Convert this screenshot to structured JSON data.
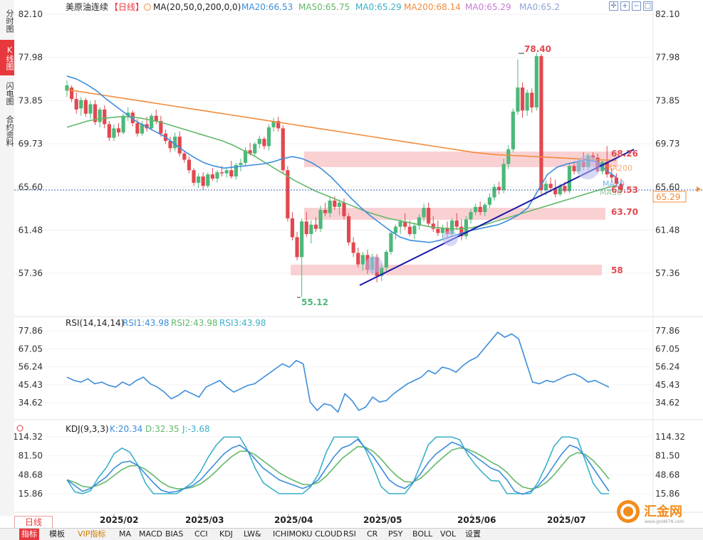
{
  "sidebar": {
    "tabs": [
      {
        "label": "分时图",
        "active": false
      },
      {
        "label": "K线图",
        "active": true
      },
      {
        "label": "闪电图",
        "active": false
      },
      {
        "label": "合约资料",
        "active": false
      }
    ]
  },
  "header": {
    "symbol": "美原油连续",
    "period_tag": "【日线】",
    "ma_params": "MA(20,50,0,200,0,0)",
    "ma_values": [
      {
        "label": "MA20:66.53",
        "color": "#3c8ddb"
      },
      {
        "label": "MA50:65.75",
        "color": "#63b86a"
      },
      {
        "label": "MA0:65.29",
        "color": "#3ab0c8"
      },
      {
        "label": "MA200:68.14",
        "color": "#f28c3c"
      },
      {
        "label": "MA0:65.29",
        "color": "#c97ad6"
      },
      {
        "label": "MA0:65.2",
        "color": "#8ea3d8"
      }
    ]
  },
  "price_axis": {
    "ticks": [
      "82.10",
      "77.98",
      "73.85",
      "69.73",
      "65.60",
      "61.48",
      "57.36"
    ],
    "current_price": "65.29"
  },
  "annotations": {
    "high": "78.40",
    "low": "55.12",
    "zone_labels": [
      "68.26",
      "63.70",
      "58",
      "65.53"
    ],
    "ma_tags": [
      "MA20",
      "MA200",
      "MA50"
    ]
  },
  "rsi": {
    "title": "RSI(14,14,14)",
    "values": [
      {
        "label": "RSI1:43.98",
        "color": "#3c8ddb"
      },
      {
        "label": "RSI2:43.98",
        "color": "#63b86a"
      },
      {
        "label": "RSI3:43.98",
        "color": "#3ab0c8"
      }
    ],
    "ticks": [
      "77.86",
      "67.05",
      "56.24",
      "45.43",
      "34.62"
    ]
  },
  "kdj": {
    "title": "KDJ(9,3,3)",
    "values": [
      {
        "label": "K:20.34",
        "color": "#3c8ddb"
      },
      {
        "label": "D:32.35",
        "color": "#63b86a"
      },
      {
        "label": "J:-3.68",
        "color": "#3ab0c8"
      }
    ],
    "ticks": [
      "114.32",
      "81.50",
      "48.68",
      "15.86"
    ]
  },
  "time_axis": {
    "labels": [
      "2025/02",
      "2025/03",
      "2025/04",
      "2025/05",
      "2025/06",
      "2025/07"
    ]
  },
  "period_button": "日线",
  "toolbar": [
    {
      "label": "指标",
      "active": true
    },
    {
      "label": "模板"
    },
    {
      "label": "VIP指标",
      "vip": true
    },
    {
      "label": "MA"
    },
    {
      "label": "MACD"
    },
    {
      "label": "BIAS"
    },
    {
      "label": "CCI"
    },
    {
      "label": "KDJ"
    },
    {
      "label": "LW&"
    },
    {
      "label": "ICHIMOKU CLOUD"
    },
    {
      "label": "RSI"
    },
    {
      "label": "CR"
    },
    {
      "label": "PSY"
    },
    {
      "label": "BOLL"
    },
    {
      "label": "VOL"
    },
    {
      "label": "设置"
    }
  ],
  "logo": {
    "text": "汇金网",
    "url_text": "www.gold678.com"
  },
  "chart_data": {
    "type": "candlestick",
    "title": "美原油连续【日线】",
    "y_range": [
      53.5,
      83.2
    ],
    "y_ticks": [
      82.1,
      77.98,
      73.85,
      69.73,
      65.6,
      61.48,
      57.36
    ],
    "x_labels": [
      "2025/02",
      "2025/03",
      "2025/04",
      "2025/05",
      "2025/06",
      "2025/07"
    ],
    "candles_ohlc": [
      [
        74.8,
        75.8,
        74.2,
        75.3
      ],
      [
        75.1,
        75.3,
        73.7,
        74.0
      ],
      [
        74.0,
        74.6,
        72.6,
        73.0
      ],
      [
        73.1,
        74.2,
        72.4,
        73.9
      ],
      [
        73.9,
        74.1,
        72.3,
        72.6
      ],
      [
        72.6,
        73.8,
        72.1,
        73.5
      ],
      [
        73.5,
        73.9,
        71.5,
        71.8
      ],
      [
        71.8,
        73.2,
        71.3,
        73.0
      ],
      [
        73.0,
        73.4,
        71.2,
        71.6
      ],
      [
        71.6,
        71.9,
        70.0,
        70.3
      ],
      [
        70.3,
        71.6,
        70.0,
        71.2
      ],
      [
        71.2,
        71.7,
        70.4,
        70.8
      ],
      [
        70.8,
        72.6,
        70.6,
        72.4
      ],
      [
        72.4,
        73.2,
        71.9,
        72.7
      ],
      [
        72.7,
        72.9,
        71.4,
        71.7
      ],
      [
        71.7,
        72.1,
        70.4,
        70.7
      ],
      [
        70.7,
        71.9,
        70.5,
        71.6
      ],
      [
        71.6,
        72.3,
        70.9,
        71.2
      ],
      [
        71.2,
        72.6,
        71.0,
        72.4
      ],
      [
        72.4,
        73.0,
        71.6,
        71.9
      ],
      [
        71.9,
        72.4,
        70.4,
        70.7
      ],
      [
        70.7,
        71.1,
        69.7,
        70.0
      ],
      [
        70.0,
        70.4,
        68.9,
        69.3
      ],
      [
        69.3,
        70.8,
        69.0,
        70.4
      ],
      [
        70.4,
        70.9,
        68.5,
        68.8
      ],
      [
        68.8,
        69.1,
        67.9,
        68.2
      ],
      [
        68.2,
        68.5,
        66.9,
        67.2
      ],
      [
        67.2,
        67.4,
        65.7,
        66.0
      ],
      [
        66.0,
        66.9,
        65.5,
        66.6
      ],
      [
        66.6,
        67.0,
        65.3,
        65.7
      ],
      [
        65.7,
        67.0,
        65.5,
        66.8
      ],
      [
        66.8,
        67.4,
        66.2,
        66.4
      ],
      [
        66.4,
        67.2,
        66.0,
        67.0
      ],
      [
        67.0,
        67.6,
        66.6,
        66.9
      ],
      [
        66.9,
        67.4,
        66.5,
        67.2
      ],
      [
        67.2,
        68.1,
        66.4,
        66.6
      ],
      [
        66.6,
        67.9,
        66.3,
        67.7
      ],
      [
        67.7,
        68.3,
        67.1,
        67.9
      ],
      [
        67.9,
        69.4,
        67.6,
        69.1
      ],
      [
        69.1,
        69.8,
        68.6,
        68.8
      ],
      [
        68.8,
        69.9,
        68.5,
        69.7
      ],
      [
        69.7,
        70.5,
        69.3,
        70.2
      ],
      [
        70.2,
        70.4,
        69.2,
        69.5
      ],
      [
        69.5,
        71.6,
        69.1,
        71.3
      ],
      [
        71.3,
        72.2,
        70.9,
        71.9
      ],
      [
        71.9,
        72.3,
        70.9,
        71.2
      ],
      [
        71.2,
        71.5,
        66.9,
        67.2
      ],
      [
        67.2,
        67.6,
        62.3,
        62.6
      ],
      [
        62.6,
        63.2,
        60.5,
        60.8
      ],
      [
        60.8,
        61.3,
        58.6,
        58.9
      ],
      [
        58.9,
        62.6,
        55.1,
        62.3
      ],
      [
        62.3,
        63.2,
        60.8,
        61.1
      ],
      [
        61.1,
        62.4,
        60.2,
        62.0
      ],
      [
        62.0,
        62.7,
        61.3,
        61.6
      ],
      [
        61.6,
        63.8,
        61.3,
        63.4
      ],
      [
        63.4,
        64.1,
        62.8,
        63.1
      ],
      [
        63.1,
        64.6,
        62.7,
        64.3
      ],
      [
        64.3,
        64.7,
        63.4,
        63.7
      ],
      [
        63.7,
        64.4,
        62.9,
        64.1
      ],
      [
        64.1,
        64.5,
        62.5,
        62.8
      ],
      [
        62.8,
        63.1,
        60.0,
        60.3
      ],
      [
        60.3,
        60.8,
        58.9,
        59.3
      ],
      [
        59.3,
        59.8,
        57.9,
        58.2
      ],
      [
        58.2,
        59.4,
        57.6,
        59.1
      ],
      [
        59.1,
        59.6,
        57.3,
        57.7
      ],
      [
        57.7,
        59.2,
        57.3,
        58.9
      ],
      [
        58.9,
        59.2,
        56.5,
        57.1
      ],
      [
        57.1,
        58.3,
        56.6,
        57.9
      ],
      [
        57.9,
        59.6,
        57.6,
        59.4
      ],
      [
        59.4,
        61.4,
        59.1,
        61.2
      ],
      [
        61.2,
        62.0,
        60.6,
        61.8
      ],
      [
        61.8,
        62.5,
        61.1,
        62.3
      ],
      [
        62.3,
        63.1,
        61.5,
        61.8
      ],
      [
        61.8,
        62.4,
        60.9,
        61.1
      ],
      [
        61.1,
        62.2,
        60.6,
        61.9
      ],
      [
        61.9,
        63.0,
        61.5,
        62.7
      ],
      [
        62.7,
        64.0,
        62.3,
        63.6
      ],
      [
        63.6,
        64.1,
        61.8,
        62.1
      ],
      [
        62.1,
        62.8,
        61.3,
        61.6
      ],
      [
        61.6,
        62.4,
        60.9,
        61.2
      ],
      [
        61.2,
        62.0,
        60.6,
        61.7
      ],
      [
        61.7,
        62.3,
        60.8,
        61.1
      ],
      [
        61.1,
        62.6,
        60.9,
        62.4
      ],
      [
        62.4,
        63.1,
        61.5,
        61.8
      ],
      [
        61.8,
        62.5,
        60.5,
        60.9
      ],
      [
        60.9,
        62.8,
        60.6,
        62.5
      ],
      [
        62.5,
        63.5,
        62.1,
        63.2
      ],
      [
        63.2,
        64.0,
        62.9,
        63.7
      ],
      [
        63.7,
        64.2,
        62.9,
        63.2
      ],
      [
        63.2,
        64.1,
        62.8,
        63.9
      ],
      [
        63.9,
        65.0,
        63.6,
        64.6
      ],
      [
        64.6,
        65.9,
        64.3,
        65.6
      ],
      [
        65.6,
        66.1,
        64.9,
        65.3
      ],
      [
        65.3,
        68.3,
        65.0,
        67.8
      ],
      [
        67.8,
        69.6,
        67.3,
        69.2
      ],
      [
        69.2,
        73.1,
        68.9,
        72.8
      ],
      [
        72.8,
        77.8,
        72.5,
        75.1
      ],
      [
        75.1,
        75.6,
        72.2,
        72.9
      ],
      [
        72.9,
        74.9,
        72.4,
        74.6
      ],
      [
        74.6,
        75.0,
        72.7,
        73.2
      ],
      [
        73.2,
        78.4,
        72.9,
        78.1
      ],
      [
        78.1,
        78.3,
        64.9,
        65.3
      ],
      [
        65.3,
        66.2,
        64.8,
        65.9
      ],
      [
        65.9,
        66.5,
        65.1,
        65.5
      ],
      [
        65.5,
        66.3,
        64.6,
        64.9
      ],
      [
        64.9,
        65.9,
        64.7,
        65.7
      ],
      [
        65.7,
        66.1,
        65.0,
        65.2
      ],
      [
        65.2,
        67.8,
        65.0,
        67.6
      ],
      [
        67.6,
        67.9,
        66.8,
        67.1
      ],
      [
        67.1,
        68.3,
        66.9,
        68.0
      ],
      [
        68.0,
        68.9,
        67.2,
        67.5
      ],
      [
        67.5,
        68.8,
        67.2,
        68.6
      ],
      [
        68.6,
        68.9,
        68.1,
        68.4
      ],
      [
        68.4,
        68.8,
        66.9,
        67.1
      ],
      [
        67.1,
        68.2,
        66.8,
        68.0
      ],
      [
        68.0,
        69.5,
        66.5,
        66.8
      ],
      [
        66.8,
        67.4,
        66.1,
        66.5
      ],
      [
        66.5,
        66.9,
        65.6,
        65.9
      ],
      [
        65.9,
        66.4,
        65.0,
        65.3
      ]
    ],
    "series": [
      {
        "name": "MA20",
        "color": "#3c8ddb",
        "values": [
          76.2,
          75.9,
          75.4,
          74.8,
          74.0,
          73.3,
          72.6,
          71.9,
          71.4,
          70.9,
          70.4,
          69.7,
          69.0,
          68.4,
          67.9,
          67.6,
          67.4,
          67.5,
          67.6,
          67.7,
          67.8,
          68.0,
          68.3,
          68.5,
          68.3,
          67.9,
          67.3,
          66.5,
          65.5,
          64.5,
          63.6,
          62.8,
          62.1,
          61.4,
          60.8,
          60.5,
          60.4,
          60.3,
          60.5,
          60.8,
          61.1,
          61.4,
          61.6,
          61.8,
          62.0,
          62.4,
          62.9,
          63.6,
          65.2,
          66.8,
          67.5,
          67.8,
          68.0,
          68.2,
          68.0,
          67.2,
          66.53
        ]
      },
      {
        "name": "MA50",
        "color": "#63b86a",
        "values": [
          71.3,
          71.6,
          71.9,
          72.1,
          72.2,
          72.3,
          72.3,
          72.2,
          72.0,
          71.8,
          71.5,
          71.2,
          70.9,
          70.6,
          70.3,
          70.0,
          69.6,
          69.1,
          68.6,
          68.0,
          67.4,
          66.8,
          66.2,
          65.7,
          65.2,
          64.8,
          64.4,
          64.0,
          63.6,
          63.2,
          62.9,
          62.6,
          62.4,
          62.2,
          62.0,
          61.8,
          61.7,
          61.6,
          61.6,
          61.7,
          61.9,
          62.2,
          62.5,
          62.8,
          63.1,
          63.4,
          63.7,
          64.0,
          64.3,
          64.6,
          64.9,
          65.2,
          65.5,
          65.75
        ]
      },
      {
        "name": "MA200",
        "color": "#f28c3c",
        "values": [
          74.9,
          74.6,
          74.3,
          74.0,
          73.7,
          73.4,
          73.1,
          72.8,
          72.5,
          72.2,
          71.9,
          71.6,
          71.3,
          71.0,
          70.7,
          70.4,
          70.1,
          69.8,
          69.5,
          69.2,
          68.9,
          68.7,
          68.6,
          68.5,
          68.4,
          68.3,
          68.2,
          68.14
        ]
      },
      {
        "name": "RSI1",
        "color": "#3c8ddb",
        "values": [
          50,
          48,
          47,
          49,
          46,
          47,
          45,
          44,
          47,
          45,
          48,
          50,
          46,
          44,
          41,
          37,
          39,
          42,
          40,
          38,
          44,
          46,
          48,
          44,
          41,
          43,
          45,
          46,
          49,
          52,
          55,
          58,
          56,
          60,
          58,
          35,
          30,
          34,
          33,
          29,
          40,
          36,
          30,
          32,
          38,
          35,
          36,
          40,
          43,
          46,
          48,
          50,
          54,
          52,
          56,
          55,
          53,
          57,
          60,
          62,
          67,
          72,
          77,
          74,
          76,
          73,
          60,
          47,
          46,
          48,
          47,
          49,
          51,
          52,
          50,
          47,
          48,
          46,
          43.98
        ]
      },
      {
        "name": "K",
        "color": "#3c8ddb",
        "values": [
          40,
          30,
          20,
          25,
          35,
          45,
          60,
          70,
          72,
          65,
          50,
          35,
          22,
          18,
          20,
          25,
          30,
          40,
          55,
          70,
          85,
          95,
          100,
          90,
          75,
          60,
          50,
          40,
          35,
          30,
          25,
          30,
          40,
          60,
          80,
          95,
          100,
          110,
          95,
          80,
          60,
          40,
          30,
          25,
          35,
          50,
          70,
          85,
          95,
          105,
          100,
          90,
          80,
          70,
          60,
          55,
          40,
          20,
          15,
          20,
          30,
          45,
          65,
          85,
          100,
          95,
          80,
          60,
          40,
          20.34
        ]
      }
    ]
  }
}
